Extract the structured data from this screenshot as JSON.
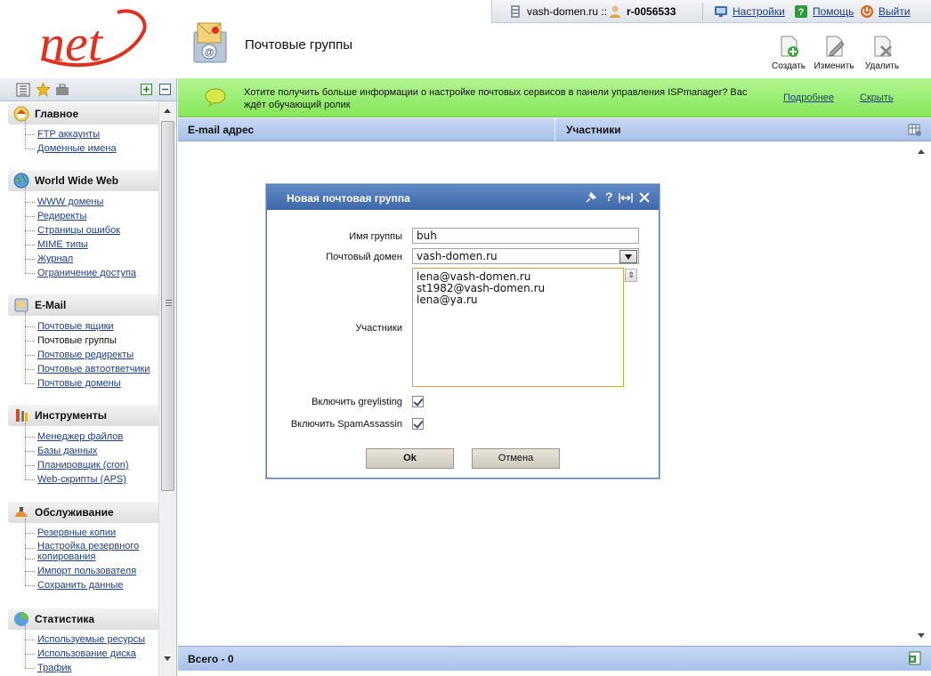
{
  "app": {
    "logo_text": "net",
    "domain": "vash-domen.ru ::",
    "user": "r-0056533",
    "settings_label": "Настройки",
    "help_label": "Помощь",
    "logout_label": "Выйти"
  },
  "page": {
    "title": "Почтовые группы"
  },
  "toolbar": {
    "create_label": "Создать",
    "edit_label": "Изменить",
    "delete_label": "Удалить"
  },
  "sidebar": {
    "sections": [
      {
        "title": "Главное",
        "items": [
          "FTP аккаунты",
          "Доменные имена"
        ]
      },
      {
        "title": "World Wide Web",
        "items": [
          "WWW домены",
          "Редиректы",
          "Страницы ошибок",
          "MIME типы",
          "Журнал",
          "Ограничение доступа"
        ]
      },
      {
        "title": "E-Mail",
        "items": [
          "Почтовые ящики",
          "Почтовые группы",
          "Почтовые редиректы",
          "Почтовые автоответчики",
          "Почтовые домены"
        ]
      },
      {
        "title": "Инструменты",
        "items": [
          "Менеджер файлов",
          "Базы данных",
          "Планировщик (cron)",
          "Web-скрипты (APS)"
        ]
      },
      {
        "title": "Обслуживание",
        "items": [
          "Резервные копии",
          "Настройка резервного",
          "копирования",
          "Импорт пользователя",
          "Сохранить данные"
        ]
      },
      {
        "title": "Статистика",
        "items": [
          "Используемые ресурсы",
          "Использование диска",
          "Трафик"
        ]
      }
    ]
  },
  "banner": {
    "line1": "Хотите получить больше информации о настройке почтовых сервисов в панели управления ISPmanager? Вас",
    "line2": "ждёт обучающий ролик",
    "more_label": "Подробнее",
    "hide_label": "Скрыть"
  },
  "table": {
    "columns": [
      "E-mail адрес",
      "Участники"
    ],
    "footer": "Всего - 0"
  },
  "dialog": {
    "title": "Новая почтовая группа",
    "fields": {
      "name_label": "Имя группы",
      "name_value": "buh",
      "domain_label": "Почтовый домен",
      "domain_value": "vash-domen.ru",
      "members_label": "Участники",
      "members_value": "lena@vash-domen.ru\nst1982@vash-domen.ru\nlena@ya.ru",
      "greylisting_label": "Включить greylisting",
      "spamassassin_label": "Включить SpamAssassin"
    },
    "ok_label": "Ok",
    "cancel_label": "Отмена"
  },
  "colors": {
    "accent_red": "#e0301e",
    "banner_green": "#9ef07a",
    "header_blue": "#a9c1ea",
    "dialog_title": "#4a74b4"
  }
}
